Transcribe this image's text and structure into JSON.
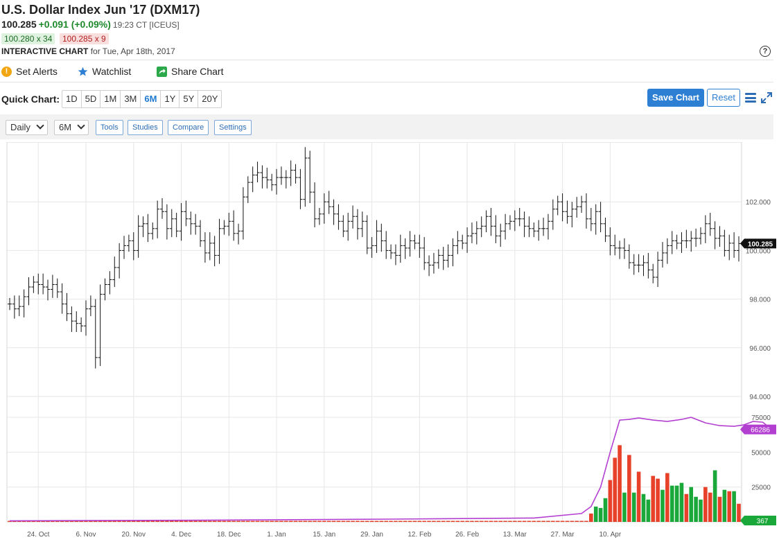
{
  "header": {
    "title": "U.S. Dollar Index Jun '17 (DXM17)",
    "last": "100.285",
    "change": "+0.091 (+0.09%)",
    "time": "19:23 CT [ICEUS]",
    "bid": "100.280 x 34",
    "ask": "100.285 x 9",
    "interactive_label": "INTERACTIVE CHART",
    "interactive_date": "for Tue, Apr 18th, 2017",
    "help": "?"
  },
  "actions": {
    "set_alerts": "Set Alerts",
    "watchlist": "Watchlist",
    "share_chart": "Share Chart",
    "alert_icon_text": "!"
  },
  "quick_chart": {
    "label": "Quick Chart:",
    "periods": [
      "1D",
      "5D",
      "1M",
      "3M",
      "6M",
      "1Y",
      "5Y",
      "20Y"
    ],
    "active": "6M"
  },
  "buttons": {
    "save": "Save Chart",
    "reset": "Reset"
  },
  "toolbar": {
    "interval": "Daily",
    "range": "6M",
    "tools": "Tools",
    "studies": "Studies",
    "compare": "Compare",
    "settings": "Settings"
  },
  "colors": {
    "up_volume": "#1aa83a",
    "down_volume": "#e8412a",
    "open_interest": "#b33fd1",
    "accent": "#2d7fd3"
  },
  "chart_data": {
    "type": "ohlc",
    "x_tick_labels": [
      "24. Oct",
      "6. Nov",
      "20. Nov",
      "4. Dec",
      "18. Dec",
      "1. Jan",
      "15. Jan",
      "29. Jan",
      "12. Feb",
      "26. Feb",
      "13. Mar",
      "27. Mar",
      "10. Apr"
    ],
    "price_axis": {
      "ticks": [
        "94.000",
        "96.000",
        "98.000",
        "100.000",
        "102.000"
      ],
      "range": [
        94,
        104
      ]
    },
    "last_price_label": "100.285",
    "price_close": [
      97.8,
      97.6,
      97.7,
      98.1,
      98.5,
      98.7,
      98.6,
      98.5,
      98.4,
      98.6,
      98.3,
      97.8,
      97.4,
      97.1,
      97.0,
      96.9,
      97.6,
      97.7,
      95.6,
      98.2,
      98.6,
      98.8,
      99.3,
      100.0,
      100.2,
      100.4,
      100.0,
      101.0,
      101.1,
      100.7,
      100.9,
      101.7,
      101.6,
      100.9,
      101.3,
      100.8,
      101.6,
      101.3,
      101.1,
      101.0,
      100.4,
      99.9,
      100.3,
      99.8,
      100.9,
      101.0,
      101.2,
      100.7,
      100.8,
      102.2,
      102.8,
      103.1,
      103.2,
      103.0,
      102.9,
      102.7,
      103.0,
      103.0,
      103.0,
      103.3,
      103.0,
      102.1,
      103.8,
      102.4,
      101.3,
      101.5,
      102.0,
      101.8,
      101.5,
      101.2,
      100.8,
      101.2,
      101.4,
      100.9,
      101.2,
      100.1,
      100.2,
      100.8,
      100.4,
      100.0,
      99.9,
      99.8,
      100.2,
      100.1,
      100.4,
      100.3,
      100.1,
      99.5,
      99.4,
      99.5,
      99.8,
      99.6,
      99.8,
      100.2,
      100.4,
      100.3,
      100.6,
      100.7,
      100.9,
      101.0,
      101.4,
      101.0,
      100.6,
      100.8,
      101.1,
      101.2,
      101.3,
      101.3,
      101.0,
      100.9,
      100.8,
      100.9,
      100.9,
      101.2,
      101.7,
      102.0,
      101.6,
      101.4,
      101.7,
      101.8,
      102.0,
      101.3,
      101.1,
      101.6,
      101.1,
      100.6,
      100.2,
      100.1,
      100.1,
      100.0,
      99.5,
      99.4,
      99.4,
      99.5,
      99.2,
      98.9,
      99.6,
      99.9,
      100.2,
      100.4,
      100.3,
      100.4,
      100.4,
      100.5,
      100.5,
      100.7,
      101.1,
      100.9,
      100.5,
      100.6,
      100.0,
      100.3,
      100.0,
      100.285
    ],
    "volume_axis": {
      "ticks": [
        "25000",
        "50000",
        "75000"
      ],
      "range": [
        0,
        80000
      ]
    },
    "open_interest_label": "66286",
    "volume_label": "367",
    "volume": [
      0,
      0,
      0,
      0,
      0,
      0,
      0,
      0,
      0,
      0,
      0,
      0,
      0,
      0,
      0,
      0,
      0,
      0,
      0,
      0,
      0,
      0,
      0,
      0,
      0,
      0,
      0,
      0,
      0,
      0,
      0,
      0,
      0,
      0,
      0,
      0,
      0,
      0,
      0,
      0,
      0,
      0,
      0,
      0,
      0,
      0,
      0,
      0,
      0,
      0,
      0,
      0,
      0,
      0,
      0,
      0,
      0,
      0,
      0,
      0,
      0,
      0,
      0,
      0,
      0,
      0,
      0,
      0,
      0,
      0,
      0,
      0,
      0,
      0,
      0,
      0,
      0,
      0,
      0,
      0,
      0,
      0,
      0,
      0,
      0,
      0,
      0,
      0,
      0,
      0,
      0,
      0,
      0,
      0,
      0,
      0,
      0,
      0,
      0,
      0,
      0,
      0,
      0,
      0,
      0,
      0,
      0,
      0,
      0,
      0,
      0,
      0,
      0,
      0,
      0,
      0,
      0,
      0,
      0,
      0,
      0,
      0,
      6000,
      11000,
      10000,
      17000,
      30000,
      46000,
      55000,
      21000,
      48000,
      21000,
      36000,
      20000,
      16000,
      33000,
      31000,
      23000,
      35000,
      26000,
      26000,
      28000,
      20000,
      25000,
      18000,
      16000,
      25000,
      21000,
      37000,
      18000,
      23000,
      22000,
      22000,
      13000
    ],
    "volume_up": [
      0,
      0,
      0,
      0,
      0,
      0,
      0,
      0,
      0,
      0,
      0,
      0,
      0,
      0,
      0,
      0,
      0,
      0,
      0,
      0,
      0,
      0,
      0,
      0,
      0,
      0,
      0,
      0,
      0,
      0,
      0,
      0,
      0,
      0,
      0,
      0,
      0,
      0,
      0,
      0,
      0,
      0,
      0,
      0,
      0,
      0,
      0,
      0,
      0,
      0,
      0,
      0,
      0,
      0,
      0,
      0,
      0,
      0,
      0,
      0,
      0,
      0,
      0,
      0,
      0,
      0,
      0,
      0,
      0,
      0,
      0,
      0,
      0,
      0,
      0,
      0,
      0,
      0,
      0,
      0,
      0,
      0,
      0,
      0,
      0,
      0,
      0,
      0,
      0,
      0,
      0,
      0,
      0,
      0,
      0,
      0,
      0,
      0,
      0,
      0,
      0,
      0,
      0,
      0,
      0,
      0,
      0,
      0,
      0,
      0,
      0,
      0,
      0,
      0,
      0,
      0,
      0,
      0,
      0,
      0,
      0,
      0,
      0,
      1,
      1,
      1,
      0,
      0,
      0,
      1,
      0,
      1,
      0,
      1,
      1,
      0,
      0,
      1,
      0,
      1,
      1,
      1,
      0,
      1,
      1,
      1,
      0,
      0,
      1,
      0,
      1,
      0,
      1,
      0
    ],
    "open_interest": [
      {
        "d": 0,
        "v": 800
      },
      {
        "d": 40,
        "v": 1200
      },
      {
        "d": 80,
        "v": 2000
      },
      {
        "d": 110,
        "v": 2800
      },
      {
        "d": 120,
        "v": 6000
      },
      {
        "d": 122,
        "v": 11000
      },
      {
        "d": 124,
        "v": 25000
      },
      {
        "d": 126,
        "v": 50000
      },
      {
        "d": 128,
        "v": 73000
      },
      {
        "d": 130,
        "v": 73500
      },
      {
        "d": 132,
        "v": 74500
      },
      {
        "d": 135,
        "v": 73000
      },
      {
        "d": 138,
        "v": 72000
      },
      {
        "d": 141,
        "v": 73500
      },
      {
        "d": 143,
        "v": 75000
      },
      {
        "d": 146,
        "v": 71000
      },
      {
        "d": 149,
        "v": 69000
      },
      {
        "d": 152,
        "v": 68500
      },
      {
        "d": 154,
        "v": 69500
      },
      {
        "d": 156,
        "v": 72000
      },
      {
        "d": 158,
        "v": 71500
      },
      {
        "d": 160,
        "v": 66286
      }
    ]
  }
}
